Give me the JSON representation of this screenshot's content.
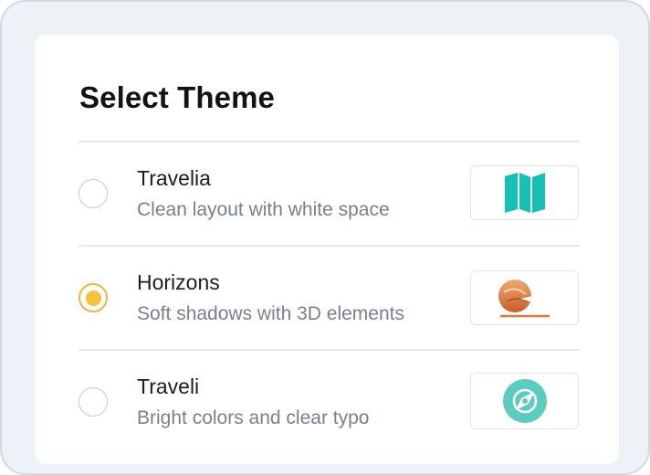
{
  "title": "Select Theme",
  "selected_theme": "Horizons",
  "themes": [
    {
      "name": "Travelia",
      "description": "Clean layout with white space",
      "icon": "folded-map-icon",
      "icon_color": "#16c1b3",
      "selected": false
    },
    {
      "name": "Horizons",
      "description": "Soft shadows with 3D elements",
      "icon": "sunset-airplane-icon",
      "icon_color": "#d9793f",
      "selected": true
    },
    {
      "name": "Traveli",
      "description": "Bright colors and clear typo",
      "icon": "compass-icon",
      "icon_color": "#5ccbc0",
      "selected": false
    }
  ],
  "colors": {
    "accent": "#f5c23e",
    "accent_ring": "#e9b83f",
    "radio_border": "#c5c9d0",
    "text_primary": "#1b1d22",
    "text_secondary": "#7a808b"
  }
}
